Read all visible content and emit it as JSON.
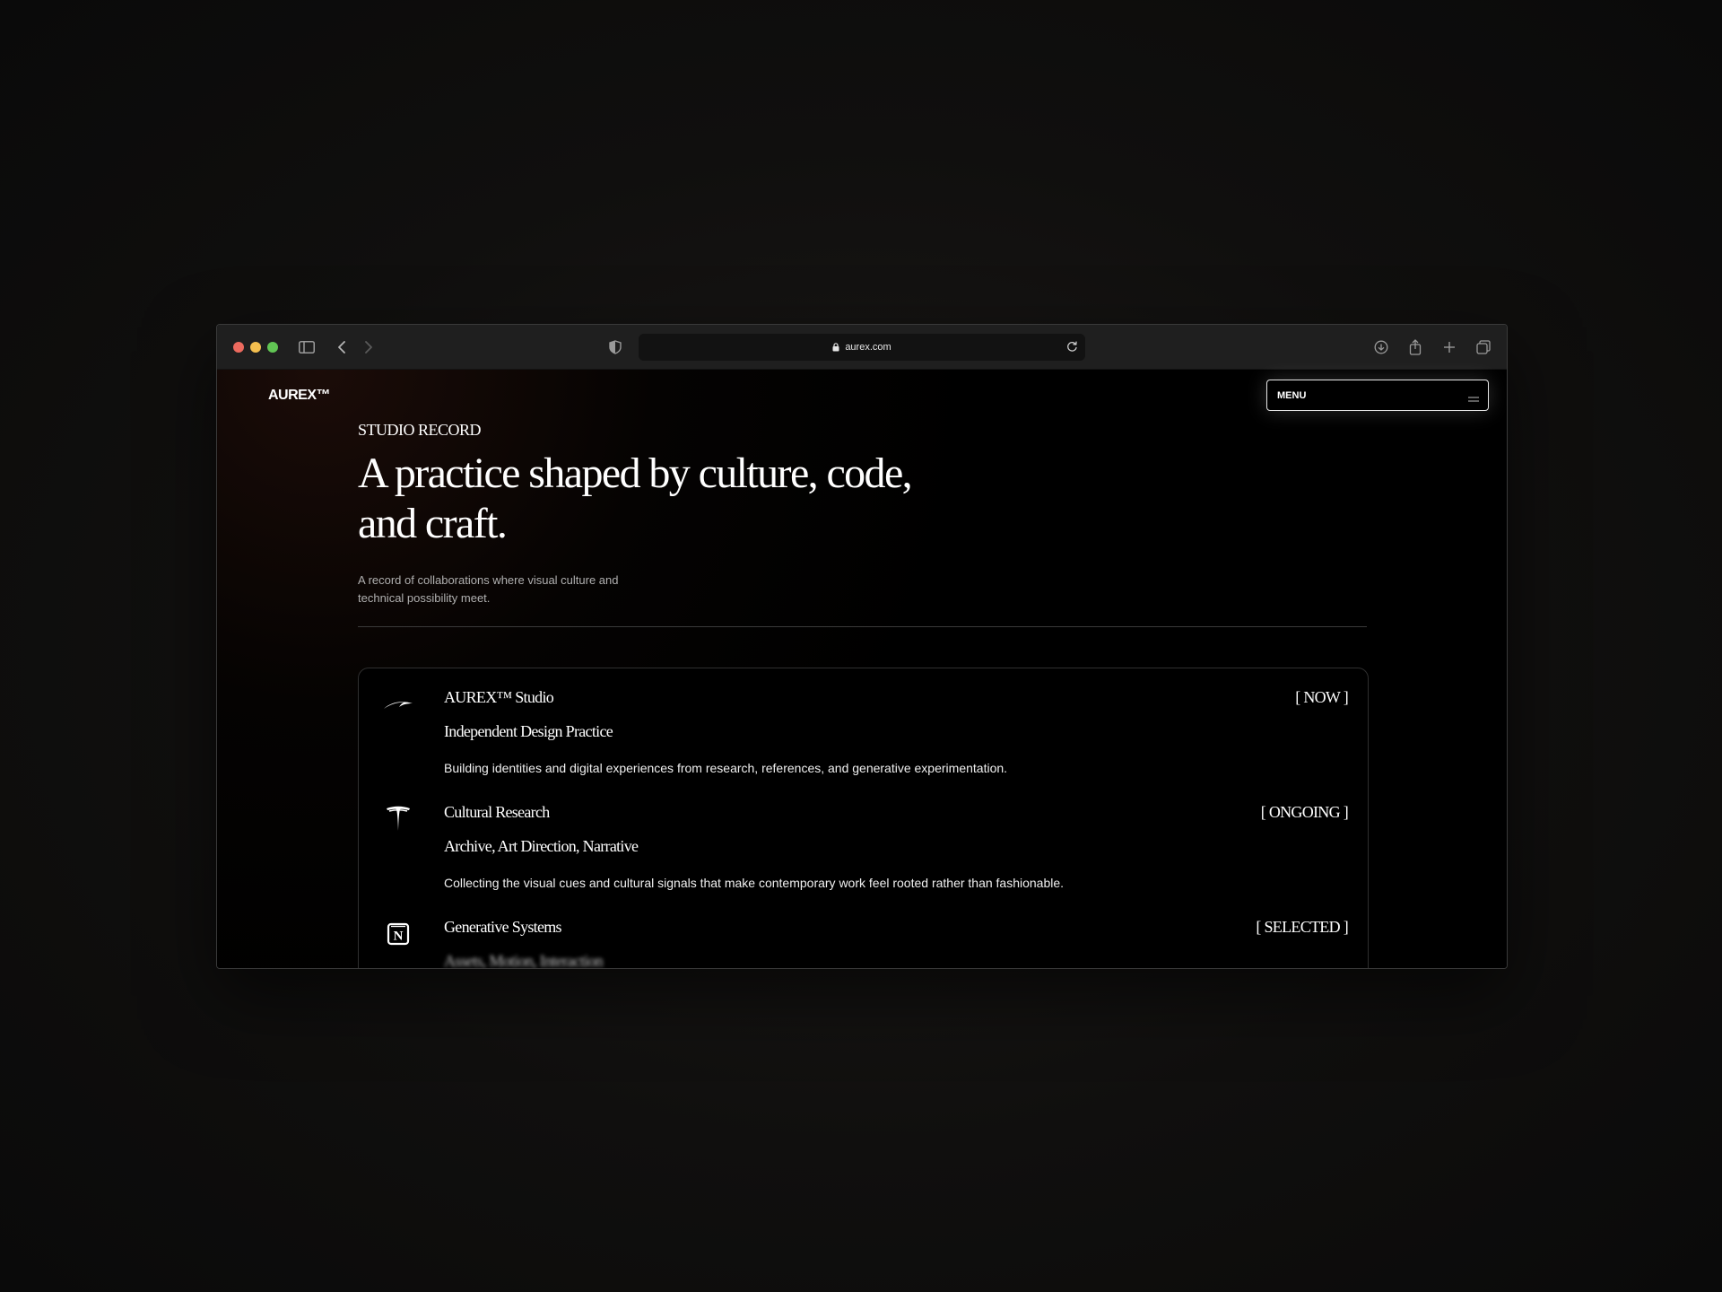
{
  "browser": {
    "url": "aurex.com"
  },
  "site": {
    "logo": "AUREX™",
    "menu_label": "MENU"
  },
  "hero": {
    "eyebrow": "STUDIO RECORD",
    "headline": "A practice shaped by culture, code, and craft.",
    "lede": "A record of collaborations where visual culture and technical possibility meet."
  },
  "entries": [
    {
      "icon": "mclaren-swoosh-icon",
      "title": "AUREX™ Studio",
      "status": "[ NOW ]",
      "subtitle": "Independent Design Practice",
      "description": "Building identities and digital experiences from research, references, and generative experimentation."
    },
    {
      "icon": "tesla-t-icon",
      "title": "Cultural Research",
      "status": "[ ONGOING ]",
      "subtitle": "Archive, Art Direction, Narrative",
      "description": "Collecting the visual cues and cultural signals that make contemporary work feel rooted rather than fashionable."
    },
    {
      "icon": "notion-n-icon",
      "title": "Generative Systems",
      "status": "[ SELECTED ]",
      "subtitle": "Assets, Motion, Interaction"
    }
  ]
}
